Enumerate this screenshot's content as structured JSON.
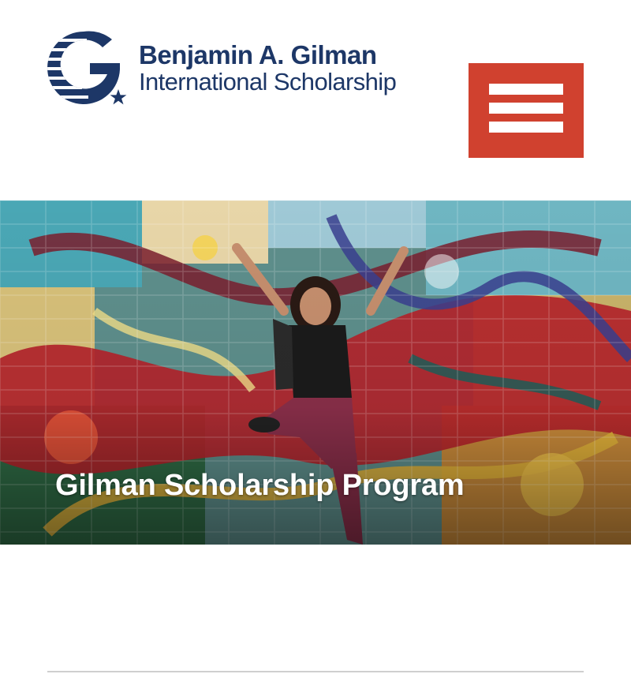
{
  "header": {
    "logo": {
      "line1": "Benjamin A. Gilman",
      "line2": "International Scholarship",
      "icon": "gilman-g-star-logo"
    },
    "menu_button": {
      "icon": "hamburger-menu-icon"
    }
  },
  "hero": {
    "title": "Gilman Scholarship Program",
    "image": "student-jumping-in-front-of-colorful-mural"
  },
  "colors": {
    "brand_navy": "#1d3767",
    "menu_red": "#d0412f",
    "divider": "#cfcfcf"
  }
}
